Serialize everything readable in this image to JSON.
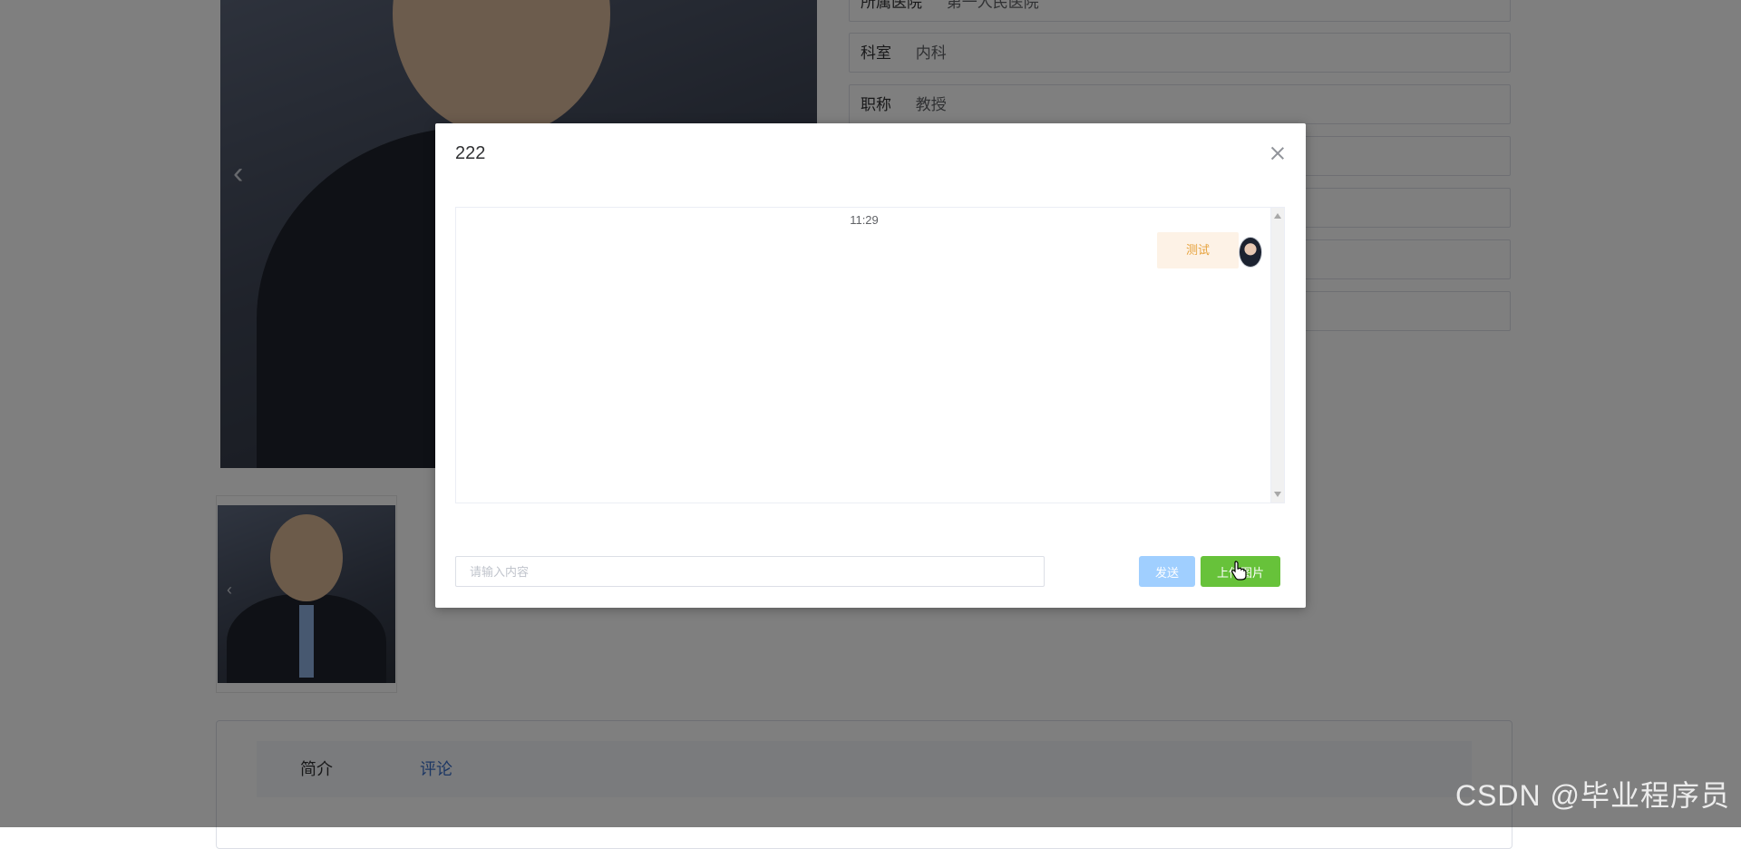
{
  "background": {
    "fields": [
      {
        "label": "所属医院",
        "value": "第一人民医院"
      },
      {
        "label": "科室",
        "value": "内科"
      },
      {
        "label": "职称",
        "value": "教授"
      },
      {
        "label": "",
        "value": ""
      },
      {
        "label": "",
        "value": ""
      },
      {
        "label": "",
        "value": ""
      },
      {
        "label": "",
        "value": ""
      }
    ],
    "tabs": [
      "简介",
      "评论"
    ],
    "carousel_prev_icon": "chevron-left-icon"
  },
  "dialog": {
    "title": "222",
    "close_icon": "close-icon",
    "messages": [
      {
        "time": "11:29",
        "text": "测试",
        "side": "right"
      }
    ],
    "input_placeholder": "请输入内容",
    "input_value": "",
    "send_label": "发送",
    "upload_label": "上传图片"
  },
  "colors": {
    "send_button": "#a0cfff",
    "upload_button": "#67c23a",
    "bubble_bg": "#fdf2e6",
    "bubble_text": "#e6a23c",
    "tab_active": "#3a6fc9"
  },
  "watermark": "CSDN @毕业程序员"
}
